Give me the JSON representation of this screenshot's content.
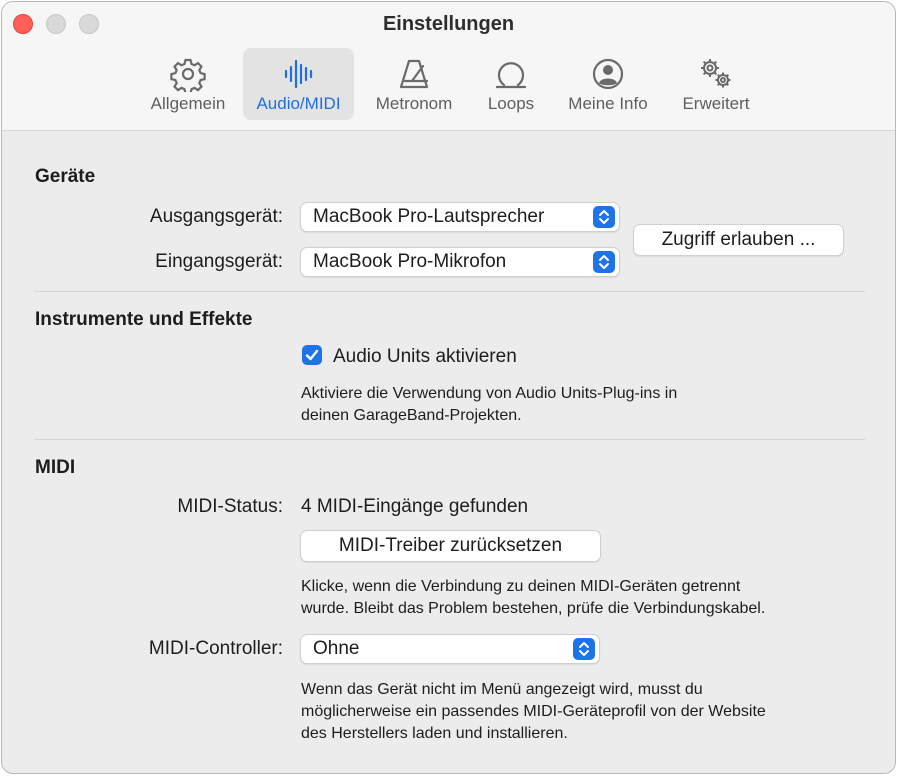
{
  "window": {
    "title": "Einstellungen"
  },
  "tabs": [
    {
      "label": "Allgemein",
      "icon": "gear-icon",
      "active": false
    },
    {
      "label": "Audio/MIDI",
      "icon": "waveform-icon",
      "active": true
    },
    {
      "label": "Metronom",
      "icon": "metronome-icon",
      "active": false
    },
    {
      "label": "Loops",
      "icon": "loop-icon",
      "active": false
    },
    {
      "label": "Meine Info",
      "icon": "person-circle-icon",
      "active": false
    },
    {
      "label": "Erweitert",
      "icon": "gears-icon",
      "active": false
    }
  ],
  "devices": {
    "title": "Geräte",
    "output_label": "Ausgangsgerät:",
    "output_value": "MacBook Pro-Lautsprecher",
    "input_label": "Eingangsgerät:",
    "input_value": "MacBook Pro-Mikrofon",
    "access_button": "Zugriff erlauben ..."
  },
  "instruments": {
    "title": "Instrumente und Effekte",
    "audio_units_label": "Audio Units aktivieren",
    "audio_units_checked": true,
    "description_line1": "Aktiviere die Verwendung von Audio Units-Plug-ins in",
    "description_line2": "deinen GarageBand-Projekten."
  },
  "midi": {
    "title": "MIDI",
    "status_label": "MIDI-Status:",
    "status_value": "4 MIDI-Eingänge gefunden",
    "reset_button": "MIDI-Treiber zurücksetzen",
    "reset_help_line1": "Klicke, wenn die Verbindung zu deinen MIDI-Geräten getrennt",
    "reset_help_line2": "wurde. Bleibt das Problem bestehen, prüfe die Verbindungskabel.",
    "controller_label": "MIDI-Controller:",
    "controller_value": "Ohne",
    "controller_help_line1": "Wenn das Gerät nicht im Menü angezeigt wird, musst du",
    "controller_help_line2": "möglicherweise ein passendes MIDI-Geräteprofil von der Website",
    "controller_help_line3": "des Herstellers laden und installieren."
  },
  "colors": {
    "accent": "#1e73e8",
    "close": "#fe5f57",
    "background": "#ececec"
  }
}
